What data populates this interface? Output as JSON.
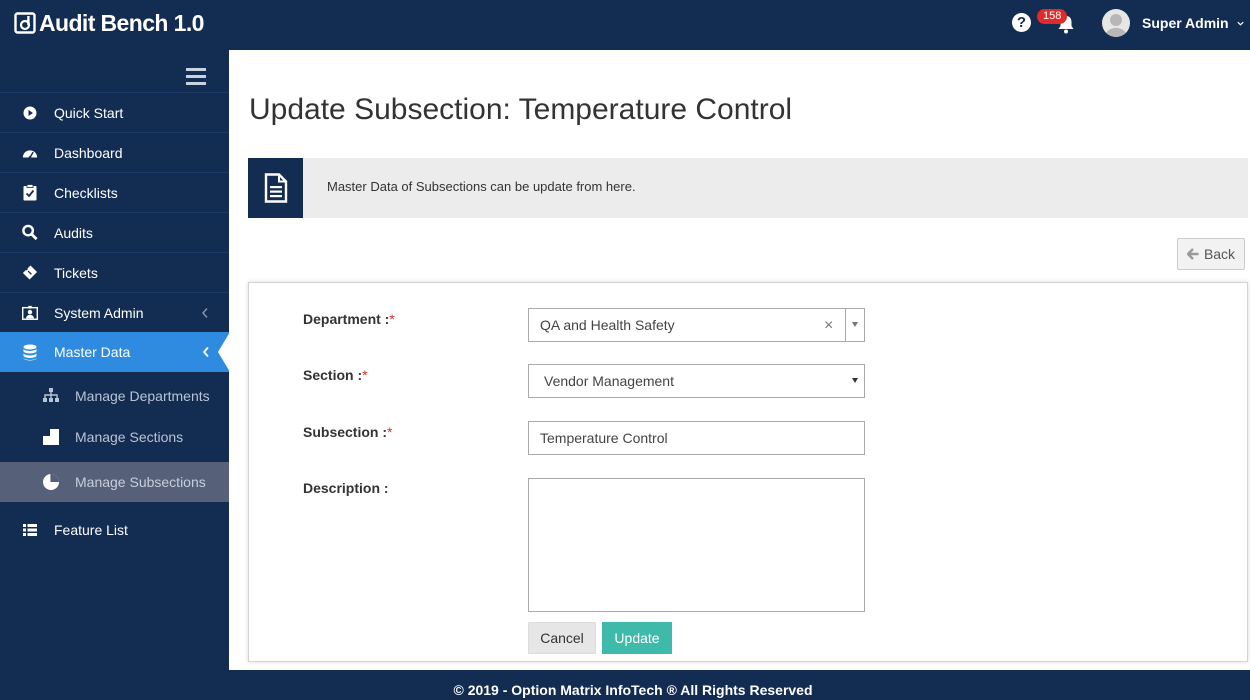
{
  "app": {
    "title": "Audit Bench 1.0"
  },
  "header": {
    "notification_count": "158",
    "help_icon": "?",
    "user_name": "Super Admin"
  },
  "sidebar": {
    "items": [
      {
        "label": "Quick Start",
        "icon": "play-circle-icon"
      },
      {
        "label": "Dashboard",
        "icon": "dashboard-icon"
      },
      {
        "label": "Checklists",
        "icon": "clipboard-icon"
      },
      {
        "label": "Audits",
        "icon": "search-icon"
      },
      {
        "label": "Tickets",
        "icon": "ticket-icon"
      },
      {
        "label": "System Admin",
        "icon": "user-admin-icon"
      },
      {
        "label": "Master Data",
        "icon": "database-icon"
      },
      {
        "label": "Feature List",
        "icon": "list-icon"
      }
    ],
    "subitems": [
      {
        "label": "Manage Departments",
        "icon": "sitemap-icon"
      },
      {
        "label": "Manage Sections",
        "icon": "section-icon"
      },
      {
        "label": "Manage Subsections",
        "icon": "pie-chart-icon"
      }
    ],
    "active_item": "Master Data",
    "active_subitem": "Manage Subsections"
  },
  "page": {
    "title": "Update Subsection: Temperature Control",
    "info_text": "Master Data of Subsections can be update from here.",
    "back_label": "Back"
  },
  "form": {
    "department_label": "Department :",
    "department_value": "QA and Health Safety",
    "section_label": "Section :",
    "section_value": "Vendor Management",
    "subsection_label": "Subsection :",
    "subsection_value": "Temperature Control",
    "description_label": "Description :",
    "description_value": "",
    "required_mark": "*",
    "clear_symbol": "×",
    "cancel_label": "Cancel",
    "update_label": "Update"
  },
  "footer": {
    "text": "© 2019 - Option Matrix InfoTech ® All Rights Reserved"
  },
  "colors": {
    "navy": "#132c52",
    "active_blue": "#2f8be0",
    "teal": "#3dbaa9",
    "badge_red": "#e02b2b"
  }
}
